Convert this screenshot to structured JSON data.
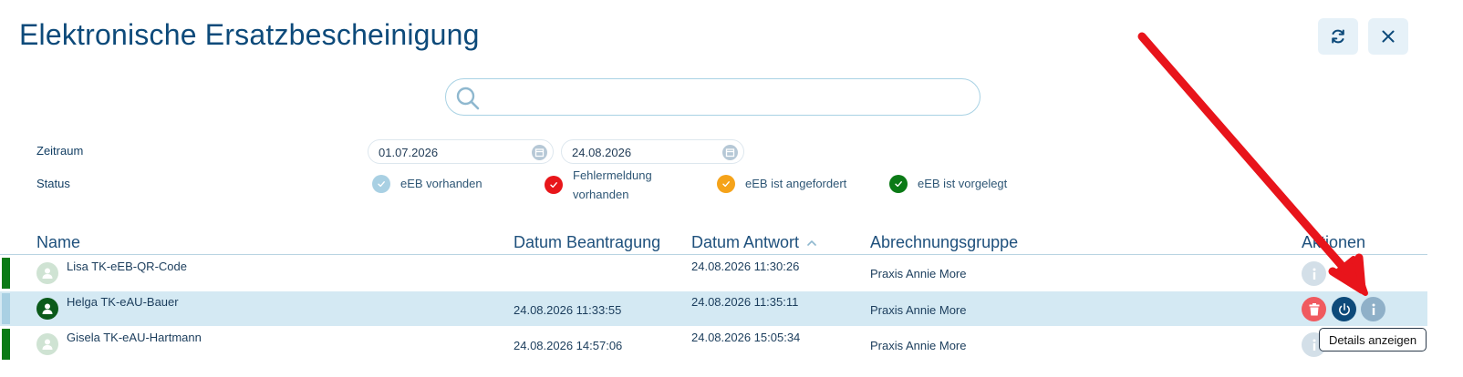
{
  "window": {
    "title": "Elektronische Ersatzbescheinigung"
  },
  "search": {
    "value": "",
    "placeholder": ""
  },
  "filters": {
    "period_label": "Zeitraum",
    "date_from": "01.07.2026",
    "date_to": "24.08.2026",
    "status_label": "Status",
    "statuses": [
      {
        "label": "eEB vorhanden",
        "color": "#a9d0e3"
      },
      {
        "label_line1": "Fehlermeldung",
        "label_line2": "vorhanden",
        "color": "#e8161a"
      },
      {
        "label": "eEB ist angefordert",
        "color": "#f5a31a"
      },
      {
        "label": "eEB ist vorgelegt",
        "color": "#0b7a16"
      }
    ]
  },
  "table": {
    "columns": {
      "name": "Name",
      "requested": "Datum Beantragung",
      "answered": "Datum Antwort",
      "group": "Abrechnungsgruppe",
      "actions": "Aktionen"
    },
    "sort_icon": "chevron-up-icon",
    "rows": [
      {
        "name": "Lisa TK-eEB-QR-Code",
        "requested": "",
        "answered": "24.08.2026 11:30:26",
        "group": "Praxis Annie More",
        "marker_color": "#0b7a16"
      },
      {
        "name": "Helga TK-eAU-Bauer",
        "requested": "24.08.2026 11:33:55",
        "answered": "24.08.2026 11:35:11",
        "group": "Praxis Annie More",
        "marker_color": "#a9d0e3"
      },
      {
        "name": "Gisela TK-eAU-Hartmann",
        "requested": "24.08.2026 14:57:06",
        "answered": "24.08.2026 15:05:34",
        "group": "Praxis Annie More",
        "marker_color": "#0b7a16"
      }
    ]
  },
  "tooltip": {
    "text": "Details anzeigen"
  },
  "colors": {
    "accent": "#0d4a7a",
    "selected_row": "#d4e9f3",
    "delete": "#f05a5f",
    "power": "#0d4a7a",
    "info": "#8fb0c8",
    "annotation_arrow": "#e8141b"
  }
}
